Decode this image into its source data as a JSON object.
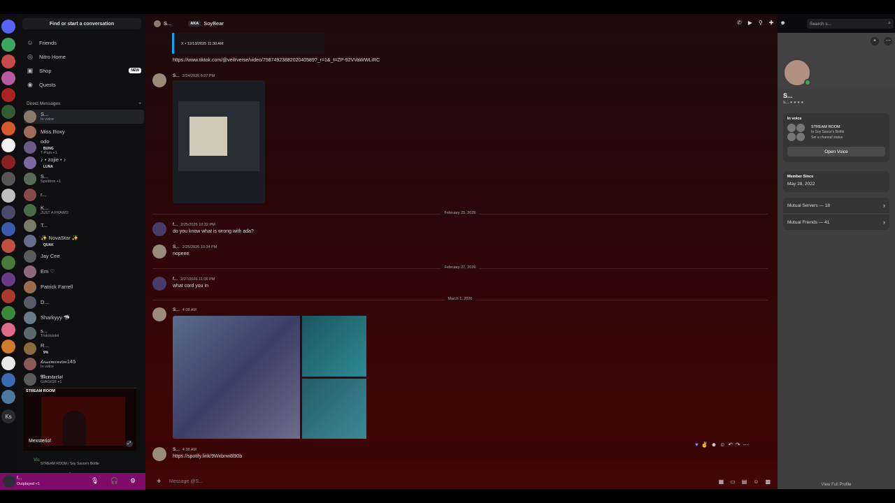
{
  "sidebar": {
    "find_label": "Find or start a conversation",
    "nav": [
      {
        "label": "Friends",
        "icon": "friends-icon"
      },
      {
        "label": "Nitro Home",
        "icon": "nitro-icon"
      },
      {
        "label": "Shop",
        "icon": "shop-icon",
        "badge": "NEW"
      },
      {
        "label": "Quests",
        "icon": "quests-icon"
      }
    ],
    "dm_header": "Direct Messages",
    "dms": [
      {
        "name": "S...",
        "sub": "In voice",
        "color": "#8a7a6a"
      },
      {
        "name": "Miss Roxy",
        "sub": "",
        "color": "#a06a5a"
      },
      {
        "name": "odo",
        "tag": "BUNG",
        "sub": "T-Pain +1",
        "color": "#6a5a8a"
      },
      {
        "name": "♪ • zojie • ♪",
        "tag": "LUNA",
        "sub": "",
        "color": "#7a6aa0"
      },
      {
        "name": "S...",
        "sub": "Spiritbox +1",
        "color": "#5a6a5a"
      },
      {
        "name": "r...",
        "sub": "",
        "color": "#8a4a4a"
      },
      {
        "name": "K...",
        "sub": "JUST A FRAWG",
        "color": "#4a6a4a"
      },
      {
        "name": "T...",
        "sub": "",
        "color": "#7a7a6a"
      },
      {
        "name": "✨ NovaStar ✨",
        "tag": "QUAK",
        "sub": "",
        "color": "#6a6a8a"
      },
      {
        "name": "Jay Cee",
        "sub": "",
        "color": "#5a5a5a"
      },
      {
        "name": "Em ♡",
        "sub": "",
        "color": "#8a6a7a"
      },
      {
        "name": "Patrick Farrell",
        "sub": "",
        "color": "#9a6a4a"
      },
      {
        "name": "D...",
        "sub": "",
        "color": "#5a5a6a"
      },
      {
        "name": "Sharkyyy 🦈",
        "sub": "",
        "color": "#6a7a8a"
      },
      {
        "name": "s...",
        "sub": "Trololololol",
        "color": "#5a6a6a"
      },
      {
        "name": "R...",
        "tag": "9%",
        "sub": "",
        "color": "#8a6a3a"
      },
      {
        "name": "𝓀𝒾𝓌𝒾𝓂𝒾𝓃𝒾𝑜𝓃145",
        "sub": "In voice",
        "color": "#8a5a5a"
      },
      {
        "name": "𝕸𝖊𝖝𝖘𝖙𝖊𝖗𝖎𝖔!",
        "sub": "GIAGIGII +1",
        "color": "#5a5a5a"
      }
    ],
    "stream": {
      "header": "STREAM ROOM",
      "who": "Mexsterio!"
    },
    "voice": {
      "status": "Vic",
      "channel": "STREAM ROOM / Soy Sauce's Bottle"
    },
    "user": {
      "name": "f...",
      "status": "Outplayed +1"
    }
  },
  "header": {
    "name": "S...",
    "aka_label": "AKA",
    "aka": "SoyBear",
    "search_placeholder": "Search s..."
  },
  "chat": {
    "embed_time": "X • 12/13/2025 11:30 AM",
    "tiktok_link": "https://www.tiktok.com/@veilrverse/video/7587492388202040589?_r=1&_t=ZP-92VVaWWLiRC",
    "messages": [
      {
        "author": "S...",
        "time": "2/24/2026 6:27 PM",
        "text": ""
      },
      {
        "author": "f...",
        "time": "2/25/2026 10:32 PM",
        "text": "do you know what is wrong with ada?"
      },
      {
        "author": "S...",
        "time": "2/25/2026 10:34 PM",
        "text": "nopeee"
      },
      {
        "author": "f...",
        "time": "2/27/2026 11:06 PM",
        "text": "what cord you in"
      },
      {
        "author": "S...",
        "time": "4:08 AM",
        "text": ""
      },
      {
        "author": "S...",
        "time": "4:38 AM",
        "text": "https://spotify.link/9Wxbnw8l90b"
      }
    ],
    "dividers": [
      "February 25, 2026",
      "February 27, 2026",
      "March 1, 2026"
    ],
    "composer_placeholder": "Message @S..."
  },
  "profile": {
    "name": "S...",
    "badges": "s...",
    "in_voice_label": "In voice",
    "voice_title": "STREAM ROOM",
    "voice_server": "In Soy Sauce's Bottle",
    "voice_status": "Set a channel status",
    "open_voice": "Open Voice",
    "member_since_label": "Member Since",
    "member_since": "May 28, 2022",
    "mutual_servers": "Mutual Servers — 18",
    "mutual_friends": "Mutual Friends — 41",
    "view_full": "View Full Profile"
  },
  "colors": {
    "link": "#00a8fc",
    "online": "#3ba55d",
    "userbar": "#7e0b6a"
  }
}
